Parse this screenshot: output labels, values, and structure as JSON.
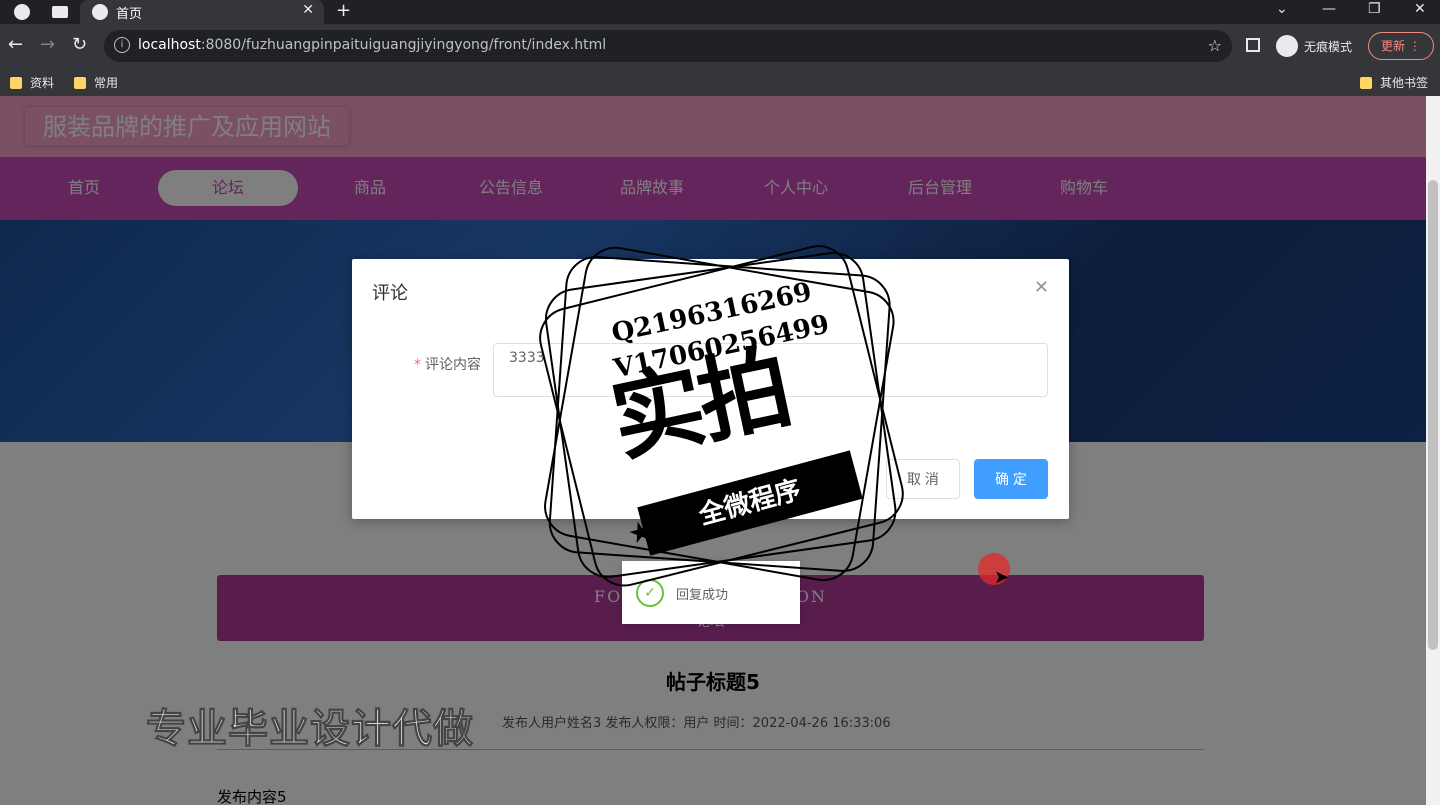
{
  "browser": {
    "tab_title": "首页",
    "url_host": "localhost",
    "url_rest": ":8080/fuzhuangpinpaituiguangjiyingyong/front/index.html",
    "incognito_label": "无痕模式",
    "update_label": "更新",
    "bookmarks": [
      "资料",
      "常用"
    ],
    "other_bookmarks": "其他书签"
  },
  "site": {
    "title": "服装品牌的推广及应用网站",
    "nav": [
      {
        "label": "首页"
      },
      {
        "label": "论坛",
        "active": true
      },
      {
        "label": "商品"
      },
      {
        "label": "公告信息"
      },
      {
        "label": "品牌故事"
      },
      {
        "label": "个人中心"
      },
      {
        "label": "后台管理"
      },
      {
        "label": "购物车"
      }
    ]
  },
  "section": {
    "en": "FORUM INFORMATION",
    "cn": "论坛"
  },
  "post": {
    "title": "帖子标题5",
    "meta": "发布人用户姓名3   发布人权限：用户   时间：2022-04-26 16:33:06",
    "content": "发布内容5"
  },
  "dialog": {
    "title": "评论",
    "field_label": "评论内容",
    "field_value": "3333",
    "cancel": "取 消",
    "confirm": "确 定"
  },
  "toast": {
    "message": "回复成功"
  },
  "watermark": {
    "line1": "Q2196316269",
    "line2": "V17060256499",
    "big": "实拍",
    "ribbon": "全微程序",
    "promo": "专业毕业设计代做"
  }
}
